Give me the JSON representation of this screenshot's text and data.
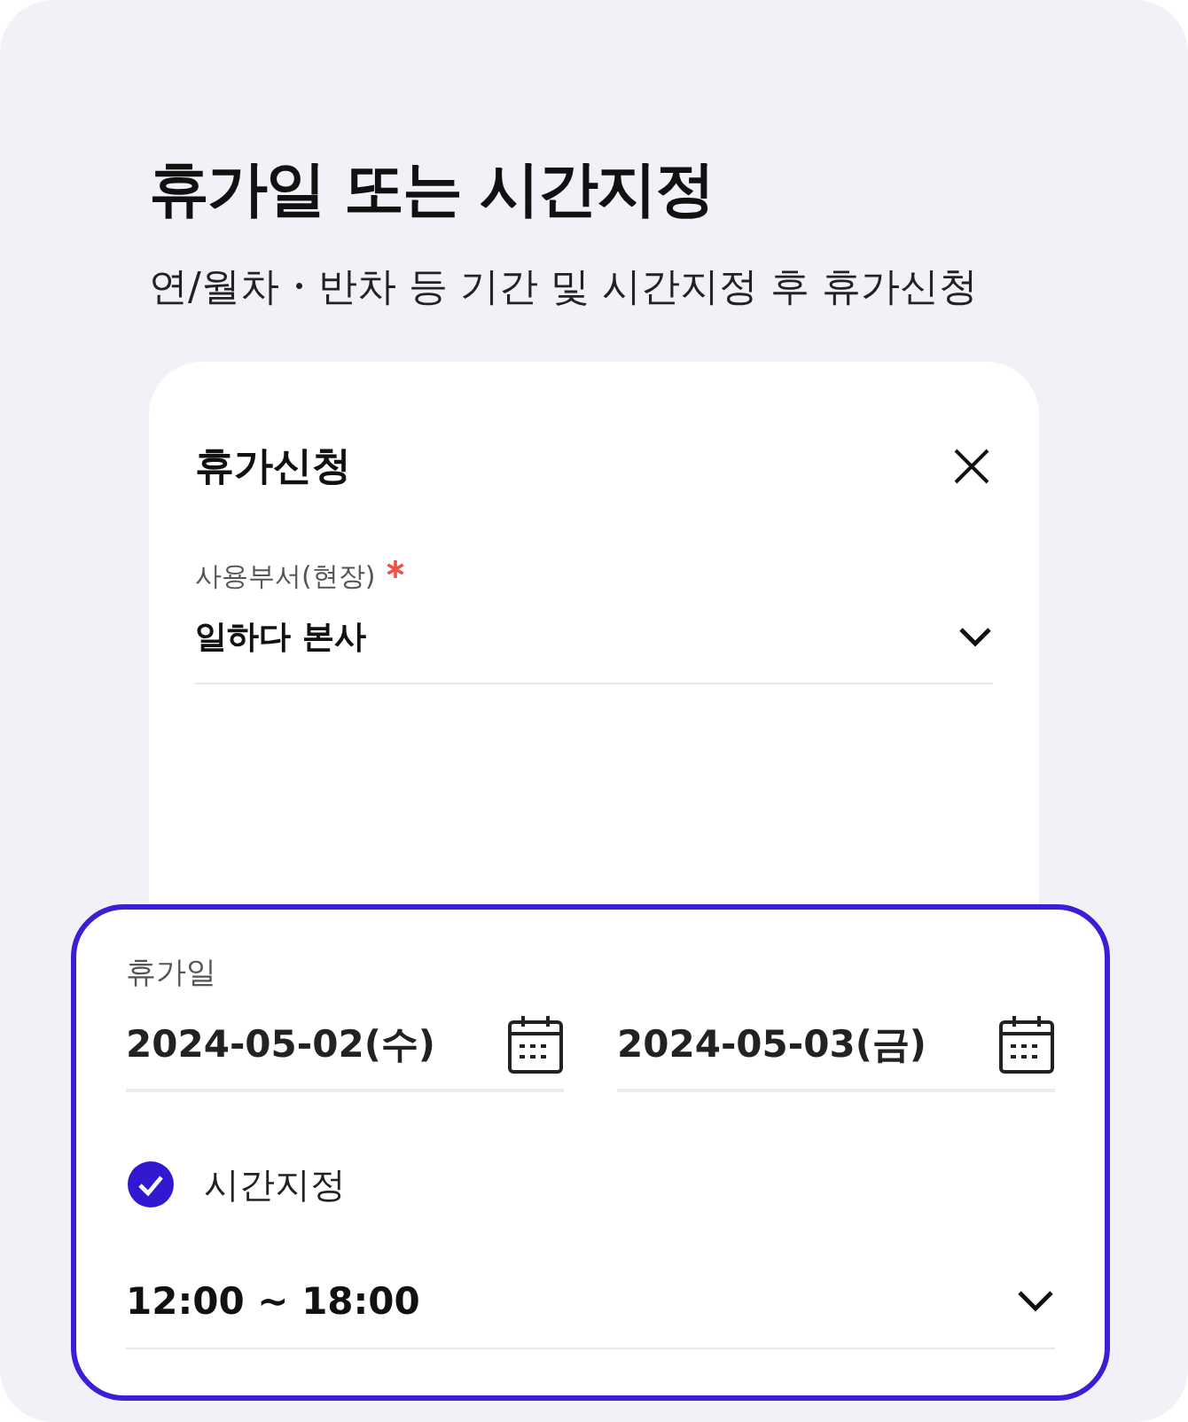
{
  "heading": {
    "title": "휴가일 또는 시간지정",
    "subtitle": "연/월차・반차 등 기간 및 시간지정 후 휴가신청"
  },
  "dialog": {
    "title": "휴가신청",
    "department": {
      "label": "사용부서(현장)",
      "required": true,
      "value": "일하다 본사"
    }
  },
  "leave_panel": {
    "label": "휴가일",
    "dates": [
      "2024-05-02(수)",
      "2024-05-03(금)"
    ],
    "time_option": {
      "label": "시간지정",
      "checked": true
    },
    "time_range": "12:00 ~ 18:00"
  }
}
